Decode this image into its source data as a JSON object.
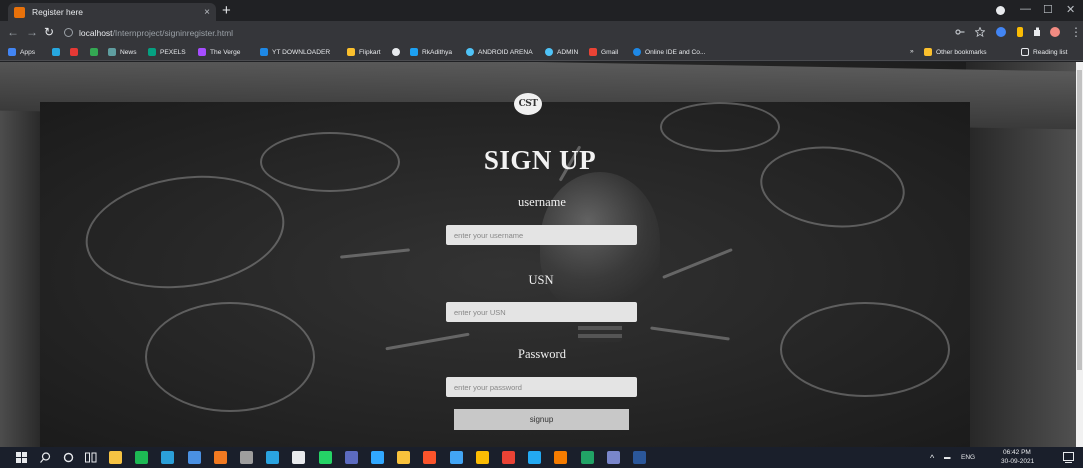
{
  "browser": {
    "tab_title": "Register here",
    "tab_close": "×",
    "new_tab": "+",
    "url_host": "localhost",
    "url_path": "/Internproject/signinregister.html",
    "bookmarks": [
      {
        "label": "Apps",
        "color": "#4285f4"
      },
      {
        "label": "",
        "color": "#27a8e0"
      },
      {
        "label": "",
        "color": "#e53935"
      },
      {
        "label": "",
        "color": "#34a853"
      },
      {
        "label": "News",
        "color": "#5f9ea0"
      },
      {
        "label": "PEXELS",
        "color": "#05a081"
      },
      {
        "label": "The Verge",
        "color": "#a64dff"
      },
      {
        "label": "YT DOWNLOADER",
        "color": "#1e88e5"
      },
      {
        "label": "Flipkart",
        "color": "#fbc02d"
      },
      {
        "label": "",
        "color": "#e8eaed"
      },
      {
        "label": "RkAdithya",
        "color": "#1da1f2"
      },
      {
        "label": "ANDROID ARENA",
        "color": "#4fc3f7"
      },
      {
        "label": "ADMIN",
        "color": "#4fc3f7"
      },
      {
        "label": "Gmail",
        "color": "#ea4335"
      },
      {
        "label": "Online IDE and Co...",
        "color": "#1e88e5"
      }
    ],
    "overflow": "»",
    "other_bookmarks": "Other bookmarks",
    "reading_list": "Reading list"
  },
  "form": {
    "logo_text": "CST",
    "title": "SIGN UP",
    "username_label": "username",
    "username_placeholder": "enter your username",
    "usn_label": "USN",
    "usn_placeholder": "enter your USN",
    "password_label": "Password",
    "password_placeholder": "enter your password",
    "submit_label": "signup"
  },
  "taskbar": {
    "apps": [
      {
        "name": "file-explorer-icon",
        "color": "#f6c343"
      },
      {
        "name": "spotify-icon",
        "color": "#1db954"
      },
      {
        "name": "app-l-icon",
        "color": "#2b9fd8"
      },
      {
        "name": "vscode-blue-icon",
        "color": "#4a90e2"
      },
      {
        "name": "illustrator-icon",
        "color": "#f27a21"
      },
      {
        "name": "chatgpt-icon",
        "color": "#9e9e9e"
      },
      {
        "name": "telegram-icon",
        "color": "#2aa3e0"
      },
      {
        "name": "store-icon",
        "color": "#e8eaed"
      },
      {
        "name": "whatsapp-icon",
        "color": "#25d366"
      },
      {
        "name": "app-circle-icon",
        "color": "#5c6bc0"
      },
      {
        "name": "photoshop-icon",
        "color": "#31a8ff"
      },
      {
        "name": "notes-icon",
        "color": "#f9c23c"
      },
      {
        "name": "brave-icon",
        "color": "#fb542b"
      },
      {
        "name": "app-blue-icon",
        "color": "#42a5f5"
      },
      {
        "name": "drive-icon",
        "color": "#fbbc04"
      },
      {
        "name": "chrome-icon",
        "color": "#ea4335"
      },
      {
        "name": "vscode-icon",
        "color": "#23a9f2"
      },
      {
        "name": "outlook-icon",
        "color": "#f57c00"
      },
      {
        "name": "excel-icon",
        "color": "#21a366"
      },
      {
        "name": "app-note-icon",
        "color": "#7986cb"
      },
      {
        "name": "word-icon",
        "color": "#2b579a"
      }
    ],
    "language": "ENG",
    "time": "06:42 PM",
    "date": "30-09-2021"
  }
}
